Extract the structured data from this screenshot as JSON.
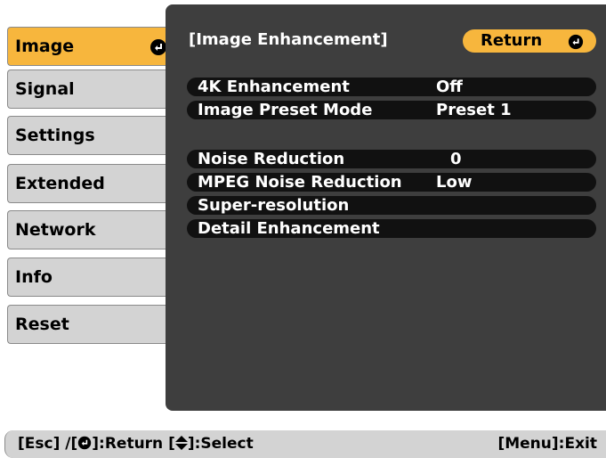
{
  "menu": {
    "items": [
      {
        "label": "Image",
        "selected": true
      },
      {
        "label": "Signal"
      },
      {
        "label": "Settings"
      },
      {
        "label": "Extended"
      },
      {
        "label": "Network"
      },
      {
        "label": "Info"
      },
      {
        "label": "Reset"
      }
    ]
  },
  "panel": {
    "title": "[Image Enhancement]",
    "return_label": "Return"
  },
  "options": [
    {
      "label": "4K Enhancement",
      "value": "Off"
    },
    {
      "label": "Image Preset Mode",
      "value": "Preset 1"
    },
    {
      "label": "Noise Reduction",
      "value": "0"
    },
    {
      "label": "MPEG Noise Reduction",
      "value": "Low"
    },
    {
      "label": "Super-resolution",
      "value": ""
    },
    {
      "label": "Detail Enhancement",
      "value": ""
    }
  ],
  "footer": {
    "esc_part": "[Esc] /[",
    "return_part": "]:Return  [",
    "select_part": "]:Select",
    "exit_label": "[Menu]:Exit"
  },
  "colors": {
    "accent": "#f7b63d",
    "panel": "#3e3e3e",
    "row": "#111111",
    "menu": "#d3d3d3"
  }
}
